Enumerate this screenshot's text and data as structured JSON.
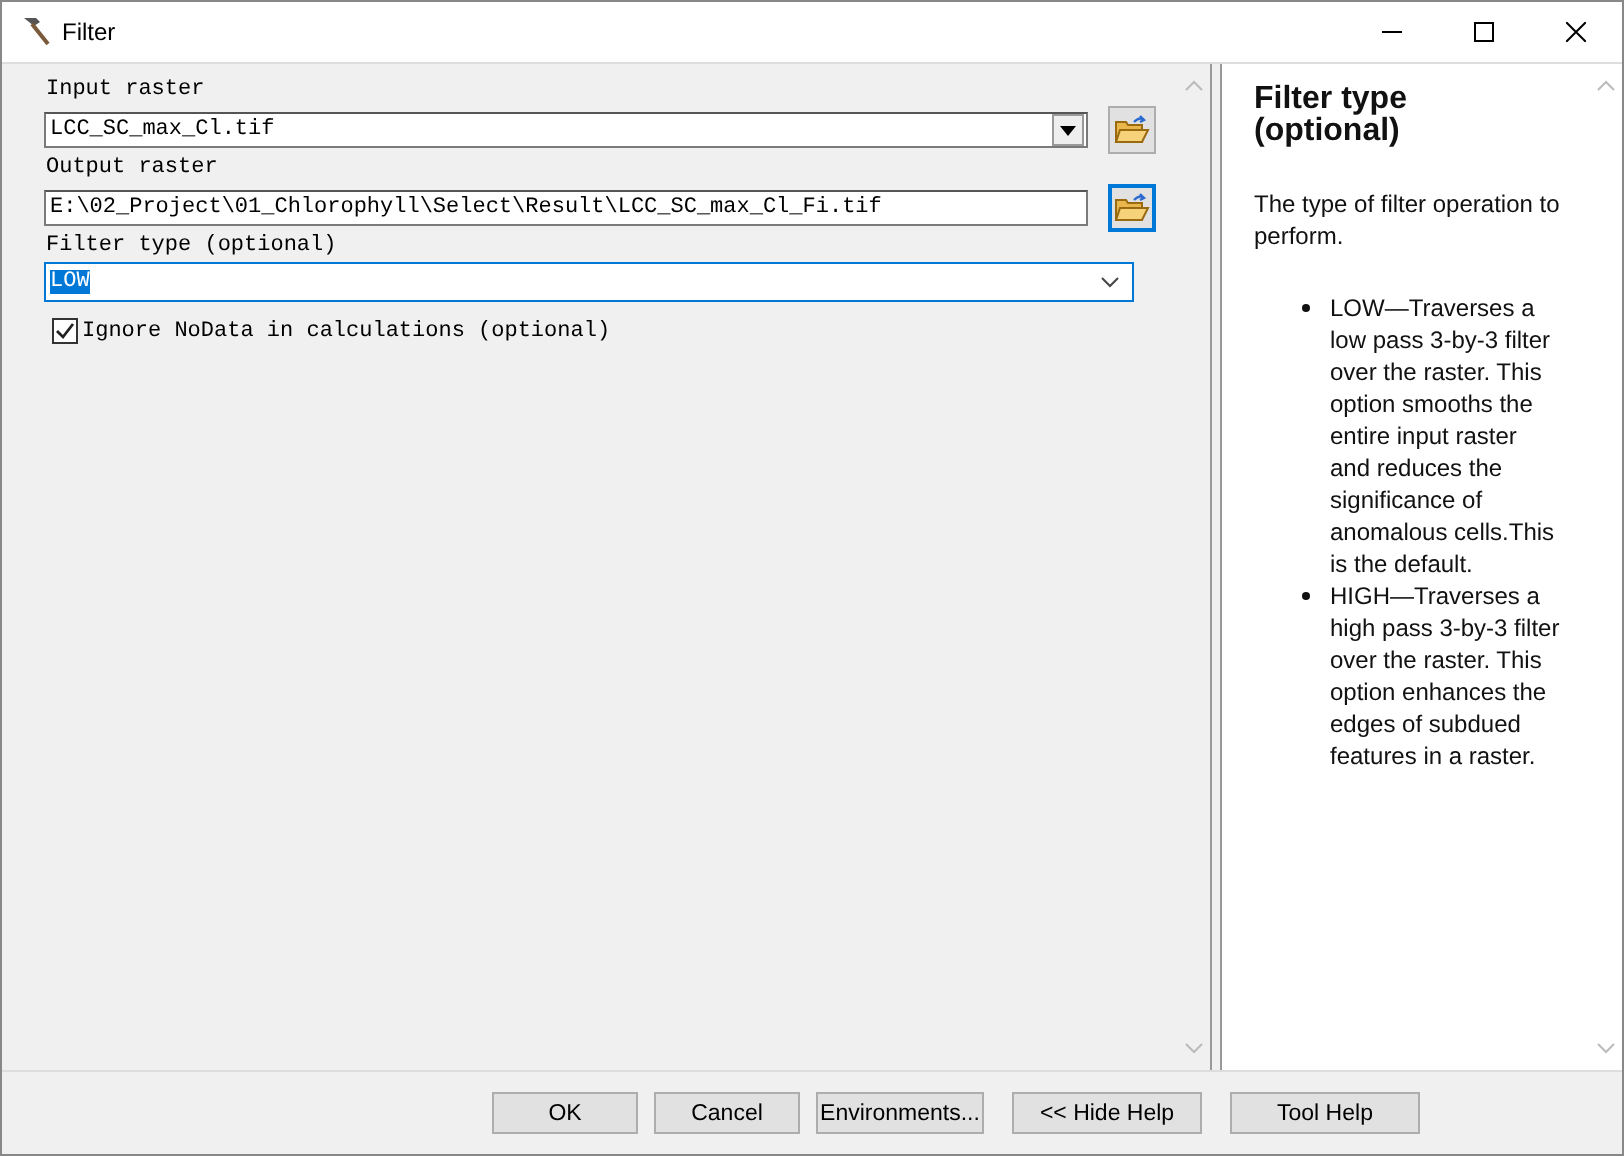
{
  "window": {
    "title": "Filter"
  },
  "parameters": [
    {
      "kind": "combo",
      "label": "Input raster",
      "value": "LCC_SC_max_Cl.tif",
      "browse_focused": false
    },
    {
      "kind": "text",
      "label": "Output raster",
      "value": "E:\\02_Project\\01_Chlorophyll\\Select\\Result\\LCC_SC_max_Cl_Fi.tif",
      "browse_focused": true
    },
    {
      "kind": "dropdown",
      "label": "Filter type (optional)",
      "value": "LOW",
      "focused": true
    },
    {
      "kind": "checkbox",
      "label": "Ignore NoData in calculations (optional)",
      "checked": true
    }
  ],
  "help": {
    "title": "Filter type (optional)",
    "description": "The type of filter operation to perform.",
    "bullets": [
      "LOW—Traverses a low pass 3-by-3 filter over the raster. This option smooths the entire input raster and reduces the significance of anomalous cells.This is the default.",
      "HIGH—Traverses a high pass 3-by-3 filter over the raster. This option enhances the edges of subdued features in a raster."
    ]
  },
  "buttons": [
    "OK",
    "Cancel",
    "Environments...",
    "<< Hide Help",
    "Tool Help"
  ]
}
